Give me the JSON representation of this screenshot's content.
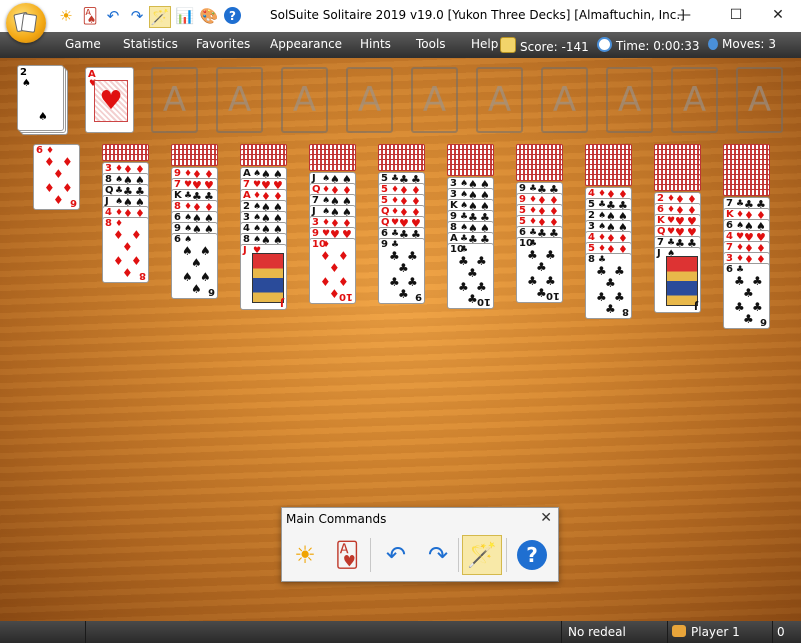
{
  "window": {
    "title": "SolSuite Solitaire 2019 v19.0  [Yukon Three Decks]  [Almaftuchin, Inc.]",
    "minimize_glyph": "—",
    "maximize_glyph": "☐",
    "close_glyph": "✕"
  },
  "quick_access": [
    {
      "name": "new-game-icon",
      "glyph": "☀"
    },
    {
      "name": "deal-icon",
      "glyph": "🂡"
    },
    {
      "name": "undo-icon",
      "glyph": "↶"
    },
    {
      "name": "redo-icon",
      "glyph": "↷"
    },
    {
      "name": "hint-wand-icon",
      "glyph": "🪄"
    },
    {
      "name": "statistics-icon",
      "glyph": "📊"
    },
    {
      "name": "appearance-icon",
      "glyph": "🎨"
    },
    {
      "name": "help-icon",
      "glyph": "?"
    }
  ],
  "menu": [
    "Game",
    "Statistics",
    "Favorites",
    "Appearance",
    "Hints",
    "Tools",
    "Help"
  ],
  "stats": {
    "score_label": "Score:",
    "score_value": "-141",
    "time_label": "Time:",
    "time_value": "0:00:33",
    "moves_label": "Moves:",
    "moves_value": "3"
  },
  "stock": {
    "rank": "2",
    "suit": "♠"
  },
  "waste": {
    "rank": "A",
    "suit": "♥"
  },
  "foundation_label": "A",
  "tableau": [
    {
      "down": 0,
      "up": [
        [
          "6",
          "♦"
        ]
      ]
    },
    {
      "down": 3,
      "up": [
        [
          "3",
          "♦"
        ],
        [
          "8",
          "♠"
        ],
        [
          "Q",
          "♣"
        ],
        [
          "J",
          "♠"
        ],
        [
          "4",
          "♦"
        ],
        [
          "8",
          "♦"
        ]
      ]
    },
    {
      "down": 4,
      "up": [
        [
          "9",
          "♦"
        ],
        [
          "7",
          "♥"
        ],
        [
          "K",
          "♣"
        ],
        [
          "8",
          "♦"
        ],
        [
          "6",
          "♠"
        ],
        [
          "9",
          "♠"
        ],
        [
          "6",
          "♠"
        ]
      ]
    },
    {
      "down": 4,
      "up": [
        [
          "A",
          "♠"
        ],
        [
          "7",
          "♥"
        ],
        [
          "A",
          "♦"
        ],
        [
          "2",
          "♠"
        ],
        [
          "3",
          "♠"
        ],
        [
          "4",
          "♠"
        ],
        [
          "8",
          "♠"
        ],
        [
          "J",
          "♥"
        ]
      ]
    },
    {
      "down": 5,
      "up": [
        [
          "J",
          "♠"
        ],
        [
          "Q",
          "♦"
        ],
        [
          "7",
          "♠"
        ],
        [
          "J",
          "♠"
        ],
        [
          "3",
          "♦"
        ],
        [
          "9",
          "♥"
        ],
        [
          "10",
          "♦"
        ]
      ]
    },
    {
      "down": 5,
      "up": [
        [
          "5",
          "♣"
        ],
        [
          "5",
          "♦"
        ],
        [
          "5",
          "♦"
        ],
        [
          "Q",
          "♦"
        ],
        [
          "Q",
          "♥"
        ],
        [
          "6",
          "♣"
        ],
        [
          "9",
          "♣"
        ]
      ]
    },
    {
      "down": 6,
      "up": [
        [
          "3",
          "♠"
        ],
        [
          "3",
          "♠"
        ],
        [
          "K",
          "♠"
        ],
        [
          "9",
          "♣"
        ],
        [
          "8",
          "♠"
        ],
        [
          "A",
          "♣"
        ],
        [
          "10",
          "♣"
        ]
      ]
    },
    {
      "down": 7,
      "up": [
        [
          "9",
          "♣"
        ],
        [
          "9",
          "♦"
        ],
        [
          "5",
          "♦"
        ],
        [
          "5",
          "♦"
        ],
        [
          "6",
          "♣"
        ],
        [
          "10",
          "♣"
        ]
      ]
    },
    {
      "down": 8,
      "up": [
        [
          "4",
          "♦"
        ],
        [
          "5",
          "♣"
        ],
        [
          "2",
          "♠"
        ],
        [
          "3",
          "♠"
        ],
        [
          "4",
          "♦"
        ],
        [
          "5",
          "♦"
        ],
        [
          "8",
          "♣"
        ]
      ]
    },
    {
      "down": 9,
      "up": [
        [
          "2",
          "♦"
        ],
        [
          "6",
          "♦"
        ],
        [
          "K",
          "♥"
        ],
        [
          "Q",
          "♥"
        ],
        [
          "7",
          "♣"
        ],
        [
          "J",
          "♠"
        ]
      ]
    },
    {
      "down": 10,
      "up": [
        [
          "7",
          "♣"
        ],
        [
          "K",
          "♦"
        ],
        [
          "6",
          "♠"
        ],
        [
          "4",
          "♥"
        ],
        [
          "7",
          "♦"
        ],
        [
          "3",
          "♦"
        ],
        [
          "6",
          "♣"
        ]
      ]
    }
  ],
  "panel": {
    "title": "Main Commands",
    "close_glyph": "✕",
    "buttons": [
      {
        "name": "new-game-icon",
        "glyph": "☀"
      },
      {
        "name": "deal-cards-icon",
        "glyph": "🂱"
      },
      {
        "name": "undo-icon",
        "glyph": "↶"
      },
      {
        "name": "redo-icon",
        "glyph": "↷"
      },
      {
        "name": "hint-wand-icon",
        "glyph": "🪄"
      },
      {
        "name": "help-icon",
        "glyph": "?"
      }
    ]
  },
  "statusbar": {
    "redeal": "No redeal",
    "player": "Player 1",
    "trailing": "0"
  },
  "colors": {
    "red_suit": "#e01010",
    "black_suit": "#111111",
    "menubar": "#3c3c3c"
  }
}
